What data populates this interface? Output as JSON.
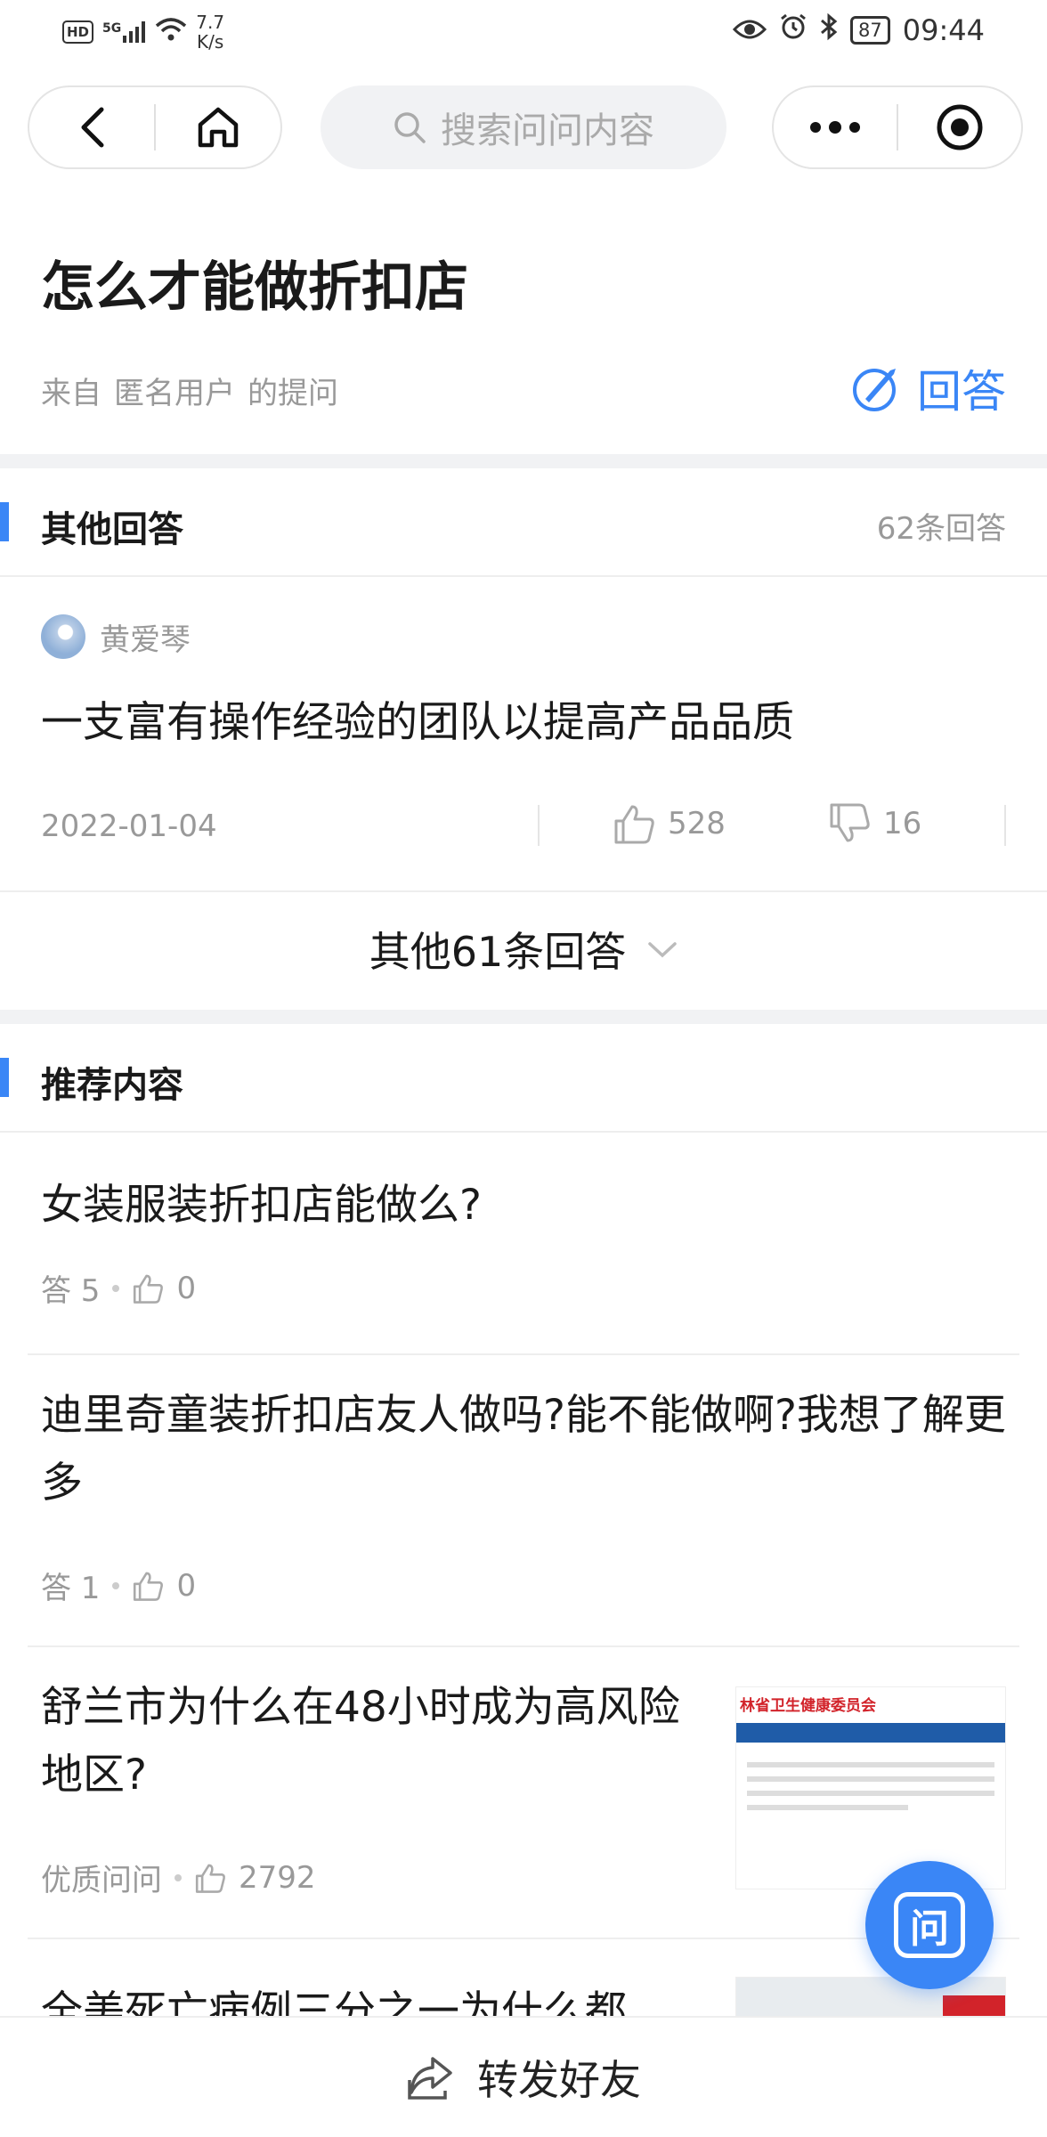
{
  "status_bar": {
    "network_badge": "HD",
    "signal_label": "5G",
    "speed_value": "7.7",
    "speed_unit": "K/s",
    "battery": "87",
    "time": "09:44"
  },
  "nav": {
    "search_placeholder": "搜索问问内容"
  },
  "question": {
    "title": "怎么才能做折扣店",
    "meta_prefix": "来自",
    "meta_user": "匿名用户",
    "meta_suffix": "的提问",
    "answer_button_label": "回答"
  },
  "other_answers": {
    "title": "其他回答",
    "count": "62条回答",
    "answer": {
      "author": "黄爱琴",
      "text": "一支富有操作经验的团队以提高产品品质",
      "date": "2022-01-04",
      "likes": "528",
      "dislikes": "16"
    },
    "more_label": "其他61条回答"
  },
  "recommended": {
    "title": "推荐内容",
    "items": [
      {
        "title": "女装服装折扣店能做么?",
        "meta_label": "答 5",
        "likes": "0"
      },
      {
        "title": "迪里奇童装折扣店友人做吗?能不能做啊?我想了解更多",
        "meta_label": "答 1",
        "likes": "0"
      },
      {
        "title": "舒兰市为什么在48小时成为高风险地区?",
        "meta_label": "优质问问",
        "likes": "2792",
        "thumb_header": "林省卫生健康委员会"
      },
      {
        "title": "全美死亡病例三分之一为什么都"
      }
    ]
  },
  "fab_label": "问",
  "bottom_bar": {
    "share_label": "转发好友"
  },
  "colors": {
    "accent": "#3a86f6",
    "muted_text": "#999999",
    "separator": "#f1f2f4"
  }
}
